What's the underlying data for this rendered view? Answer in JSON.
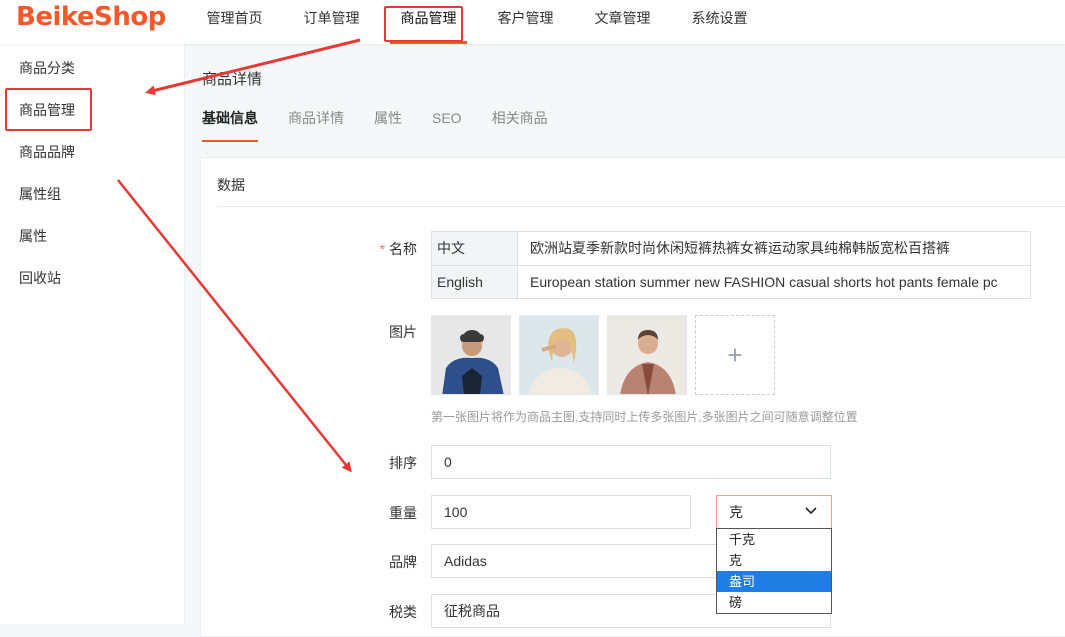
{
  "header": {
    "logo": "BeikeShop",
    "nav": [
      "管理首页",
      "订单管理",
      "商品管理",
      "客户管理",
      "文章管理",
      "系统设置"
    ],
    "active_nav": "商品管理"
  },
  "sidebar": {
    "items": [
      "商品分类",
      "商品管理",
      "商品品牌",
      "属性组",
      "属性",
      "回收站"
    ]
  },
  "main": {
    "page_title": "商品详情",
    "tabs": [
      "基础信息",
      "商品详情",
      "属性",
      "SEO",
      "相关商品"
    ],
    "active_tab": "基础信息",
    "card_title": "数据",
    "form": {
      "name_label": "名称",
      "required_mark": "*",
      "names": [
        {
          "lang": "中文",
          "value": "欧洲站夏季新款时尚休闲短裤热裤女裤运动家具纯棉韩版宽松百搭裤"
        },
        {
          "lang": "English",
          "value": "European station summer new FASHION casual shorts hot pants female pc"
        }
      ],
      "images_label": "图片",
      "add_image_symbol": "+",
      "images_hint": "第一张图片将作为商品主图,支持同时上传多张图片,多张图片之间可随意调整位置",
      "sort_label": "排序",
      "sort_value": "0",
      "weight_label": "重量",
      "weight_value": "100",
      "weight_unit": "克",
      "weight_unit_options": [
        "千克",
        "克",
        "盎司",
        "磅"
      ],
      "weight_unit_highlighted": "盎司",
      "brand_label": "品牌",
      "brand_value": "Adidas",
      "tax_label": "税类",
      "tax_value": "征税商品"
    }
  },
  "colors": {
    "brand": "#f1592a",
    "annotation": "#e53935",
    "dropdown_highlight": "#1e7ee6"
  }
}
